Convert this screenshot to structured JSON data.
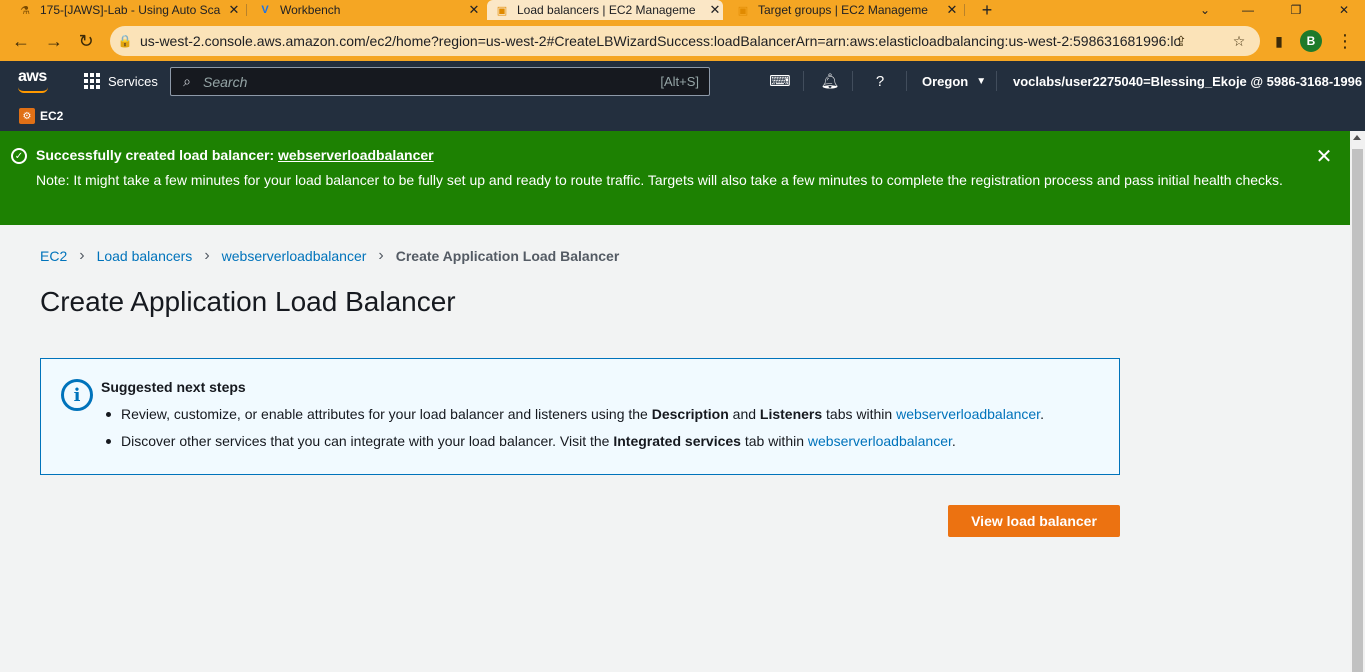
{
  "browser": {
    "tabs": [
      {
        "title": "175-[JAWS]-Lab - Using Auto Sca",
        "favicon": "lab-icon"
      },
      {
        "title": "Workbench",
        "favicon": "vocareum-icon"
      },
      {
        "title": "Load balancers | EC2 Manageme",
        "favicon": "aws-cube-icon"
      },
      {
        "title": "Target groups | EC2 Manageme",
        "favicon": "aws-cube-icon"
      }
    ],
    "active_tab": 2,
    "url": "us-west-2.console.aws.amazon.com/ec2/home?region=us-west-2#CreateLBWizardSuccess:loadBalancerArn=arn:aws:elasticloadbalancing:us-west-2:598631681996:load...",
    "profile_initial": "B",
    "accent_color": "#f5a623"
  },
  "aws_nav": {
    "logo": "aws",
    "services_label": "Services",
    "search_placeholder": "Search",
    "search_shortcut": "[Alt+S]",
    "region": "Oregon",
    "account": "voclabs/user2275040=Blessing_Ekoje @ 5986-3168-1996"
  },
  "service_bar": {
    "service_name": "EC2"
  },
  "flash": {
    "heading_prefix": "Successfully created load balancer: ",
    "heading_link": "webserverloadbalancer",
    "note": "Note: It might take a few minutes for your load balancer to be fully set up and ready to route traffic. Targets will also take a few minutes to complete the registration process and pass initial health checks.",
    "color": "#1d8102"
  },
  "breadcrumb": {
    "items": [
      "EC2",
      "Load balancers",
      "webserverloadbalancer"
    ],
    "current": "Create Application Load Balancer"
  },
  "page": {
    "title": "Create Application Load Balancer"
  },
  "info": {
    "title": "Suggested next steps",
    "step1": {
      "text_a": "Review, customize, or enable attributes for your load balancer and listeners using the ",
      "bold_a": "Description",
      "text_b": " and ",
      "bold_b": "Listeners",
      "text_c": " tabs within ",
      "link": "webserverloadbalancer",
      "text_d": "."
    },
    "step2": {
      "text_a": "Discover other services that you can integrate with your load balancer. Visit the ",
      "bold_a": "Integrated services",
      "text_b": " tab within ",
      "link": "webserverloadbalancer",
      "text_c": "."
    }
  },
  "actions": {
    "view_button": "View load balancer",
    "button_color": "#ec7211"
  }
}
